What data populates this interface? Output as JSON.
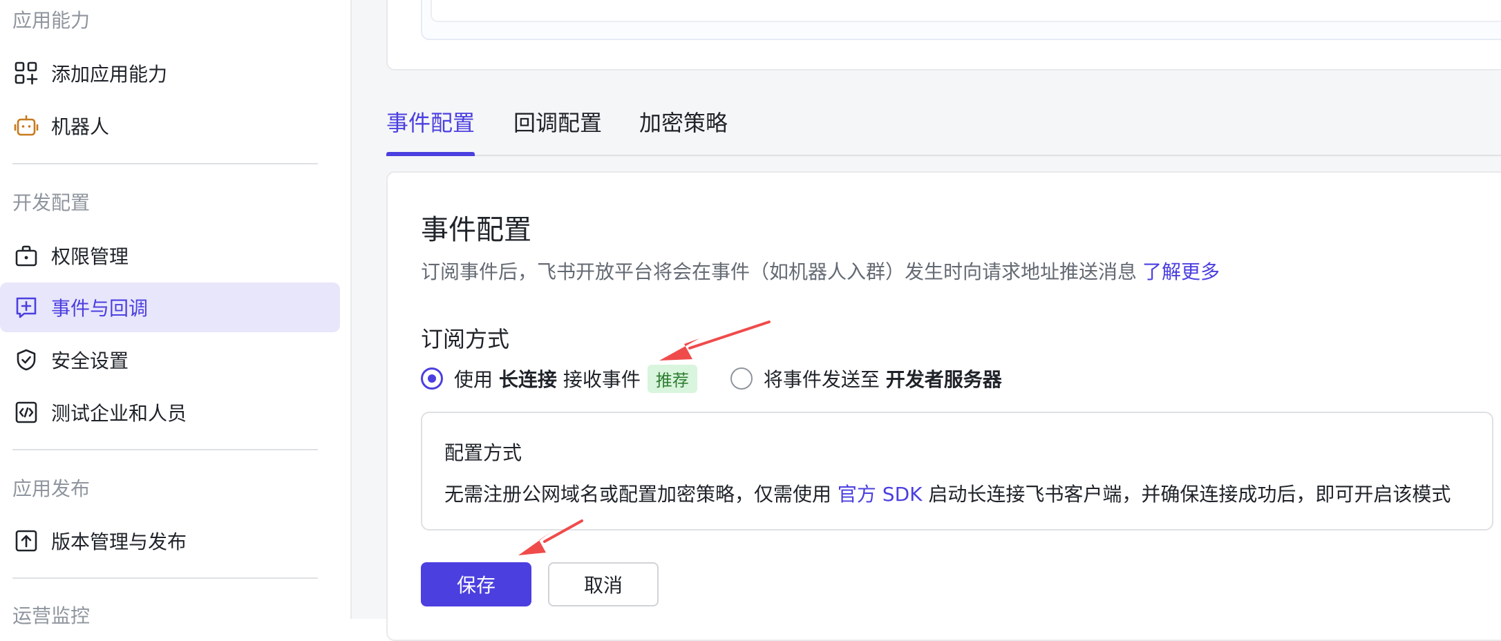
{
  "sidebar": {
    "groups": [
      {
        "title": "应用能力"
      },
      {
        "title": "开发配置"
      },
      {
        "title": "应用发布"
      },
      {
        "title": "运营监控"
      }
    ],
    "items": [
      {
        "label": "添加应用能力",
        "icon": "grid-plus-icon"
      },
      {
        "label": "机器人",
        "icon": "robot-icon"
      },
      {
        "label": "权限管理",
        "icon": "lock-box-icon"
      },
      {
        "label": "事件与回调",
        "icon": "event-plus-icon",
        "active": true
      },
      {
        "label": "安全设置",
        "icon": "shield-check-icon"
      },
      {
        "label": "测试企业和人员",
        "icon": "code-test-icon"
      },
      {
        "label": "版本管理与发布",
        "icon": "upload-box-icon"
      }
    ]
  },
  "tabs": [
    {
      "label": "事件配置",
      "active": true
    },
    {
      "label": "回调配置"
    },
    {
      "label": "加密策略"
    }
  ],
  "section": {
    "title": "事件配置",
    "description": "订阅事件后，飞书开放平台将会在事件（如机器人入群）发生时向请求地址推送消息",
    "learn_more": "了解更多",
    "subscribe_title": "订阅方式",
    "option1": {
      "prefix": "使用",
      "bold": "长连接",
      "suffix": "接收事件",
      "badge": "推荐",
      "checked": true
    },
    "option2": {
      "prefix": "将事件发送至",
      "bold": "开发者服务器",
      "checked": false
    },
    "config": {
      "title": "配置方式",
      "text_before": "无需注册公网域名或配置加密策略，仅需使用 ",
      "link": "官方 SDK",
      "text_after": " 启动长连接飞书客户端，并确保连接成功后，即可开启该模式"
    },
    "save_label": "保存",
    "cancel_label": "取消"
  },
  "colors": {
    "accent": "#4b3fe0",
    "badge_bg": "#d9f5dd",
    "badge_text": "#2e7d32",
    "annotation": "#f04b4b"
  }
}
